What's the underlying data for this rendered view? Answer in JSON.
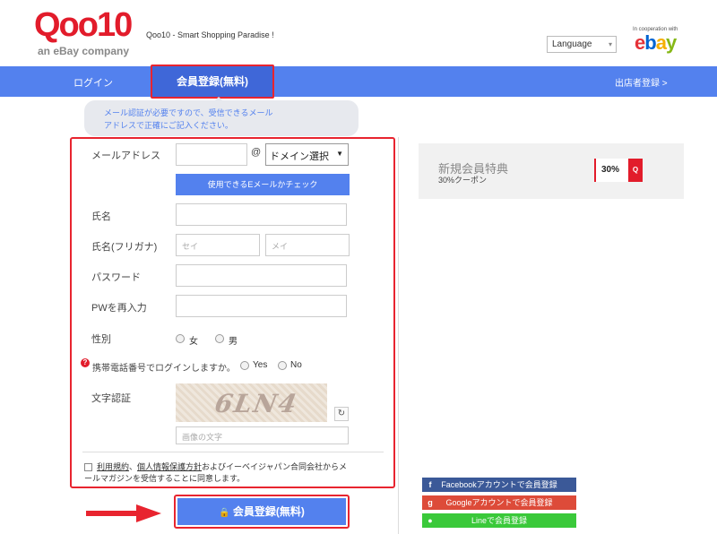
{
  "header": {
    "logo_text": "Qoo10",
    "logo_sub": "an eBay company",
    "tagline": "Qoo10 - Smart Shopping Paradise !",
    "language_label": "Language",
    "ebay_coop": "In cooperation with",
    "ebay_logo": "ebay"
  },
  "nav": {
    "login": "ログイン",
    "register": "会員登録(無料)",
    "seller": "出店者登録 >"
  },
  "notice": {
    "line1": "メール認証が必要ですので、受信できるメール",
    "line2": "アドレスで正確にご記入ください。"
  },
  "form": {
    "email_label": "メールアドレス",
    "at_sign": "@",
    "domain_select": "ドメイン選択",
    "check_button": "使用できるEメールかチェック",
    "name_label": "氏名",
    "kana_label": "氏名(フリガナ)",
    "kana_sei_placeholder": "セイ",
    "kana_mei_placeholder": "メイ",
    "password_label": "パスワード",
    "password_confirm_label": "PWを再入力",
    "gender_label": "性別",
    "gender_female": "女",
    "gender_male": "男",
    "phone_login_question": "携帯電話番号でログインしますか。",
    "phone_yes": "Yes",
    "phone_no": "No",
    "captcha_label": "文字認証",
    "captcha_text": "6LN4",
    "captcha_input_placeholder": "画像の文字",
    "agree_terms": "利用規約",
    "agree_sep": "、",
    "agree_privacy": "個人情報保護方針",
    "agree_rest": "およびイーベイジャパン合同会社からメールマガジンを受信することに同意します。",
    "submit": "会員登録(無料)"
  },
  "benefit": {
    "title": "新規会員特典",
    "subtitle": "30%クーポン",
    "coupon": "30%",
    "coupon_badge": "Q"
  },
  "social": {
    "facebook": "Facebookアカウントで会員登録",
    "google": "Googleアカウントで会員登録",
    "line": "Lineで会員登録"
  },
  "colors": {
    "brand_red": "#e21c2b",
    "nav_blue": "#5381ee",
    "highlight_red": "#e8242f"
  }
}
